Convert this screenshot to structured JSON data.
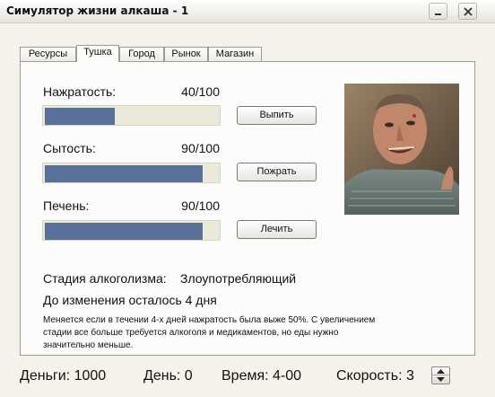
{
  "window": {
    "title": "Симулятор жизни алкаша - 1"
  },
  "tabs": [
    {
      "label": "Ресурсы"
    },
    {
      "label": "Тушка",
      "active": true
    },
    {
      "label": "Город"
    },
    {
      "label": "Рынок"
    },
    {
      "label": "Магазин"
    }
  ],
  "stats": [
    {
      "label": "Нажратость:",
      "value_text": "40/100",
      "fraction": 0.4,
      "button": "Выпить"
    },
    {
      "label": "Сытость:",
      "value_text": "90/100",
      "fraction": 0.9,
      "button": "Пожрать"
    },
    {
      "label": "Печень:",
      "value_text": "90/100",
      "fraction": 0.9,
      "button": "Лечить"
    }
  ],
  "stage": {
    "label": "Стадия алкоголизма:",
    "value": "Злоупотребляющий",
    "remaining": "До изменения осталось 4 дня",
    "note": "Меняется если в течении 4-х дней нажратость была выже 50%. С увеличением стадии все больше требуется алкоголя и медикаментов, но еды нужно значительно меньше."
  },
  "status": {
    "money": "Деньги: 1000",
    "day": "День: 0",
    "time": "Время: 4-00",
    "speed": "Скорость: 3"
  },
  "colors": {
    "bar_fill": "#59709a",
    "bar_track": "#ece9d8"
  }
}
